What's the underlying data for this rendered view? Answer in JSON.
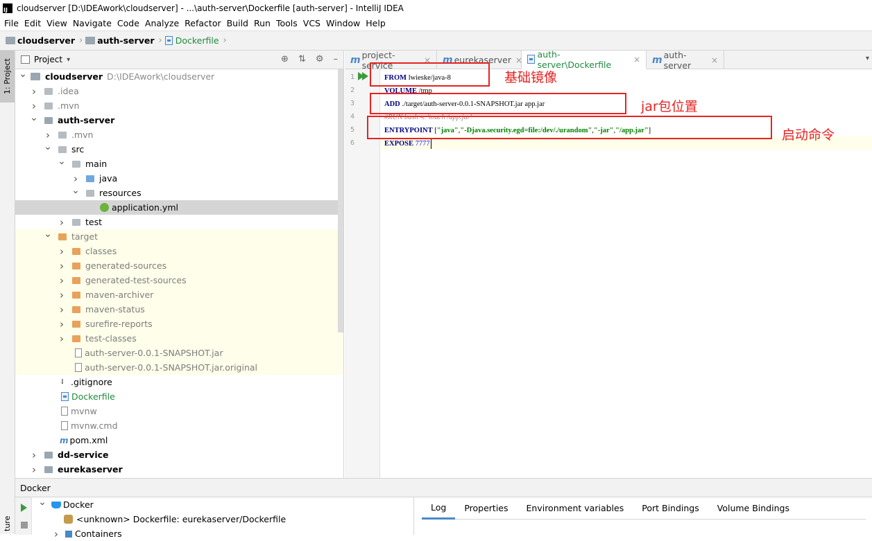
{
  "window": {
    "title": "cloudserver [D:\\IDEAwork\\cloudserver] - ...\\auth-server\\Dockerfile [auth-server] - IntelliJ IDEA",
    "logo": "IJ"
  },
  "menu": [
    "File",
    "Edit",
    "View",
    "Navigate",
    "Code",
    "Analyze",
    "Refactor",
    "Build",
    "Run",
    "Tools",
    "VCS",
    "Window",
    "Help"
  ],
  "breadcrumb": [
    "cloudserver",
    "auth-server",
    "Dockerfile"
  ],
  "left_stripe": {
    "project_tab": "1: Project",
    "structure_tab": "ture"
  },
  "project_panel": {
    "title": "Project",
    "tree": [
      {
        "label": "cloudserver",
        "path": "D:\\IDEAwork\\cloudserver"
      },
      {
        "label": ".idea"
      },
      {
        "label": ".mvn"
      },
      {
        "label": "auth-server"
      },
      {
        "label": ".mvn"
      },
      {
        "label": "src"
      },
      {
        "label": "main"
      },
      {
        "label": "java"
      },
      {
        "label": "resources"
      },
      {
        "label": "application.yml"
      },
      {
        "label": "test"
      },
      {
        "label": "target"
      },
      {
        "label": "classes"
      },
      {
        "label": "generated-sources"
      },
      {
        "label": "generated-test-sources"
      },
      {
        "label": "maven-archiver"
      },
      {
        "label": "maven-status"
      },
      {
        "label": "surefire-reports"
      },
      {
        "label": "test-classes"
      },
      {
        "label": "auth-server-0.0.1-SNAPSHOT.jar"
      },
      {
        "label": "auth-server-0.0.1-SNAPSHOT.jar.original"
      },
      {
        "label": ".gitignore"
      },
      {
        "label": "Dockerfile"
      },
      {
        "label": "mvnw"
      },
      {
        "label": "mvnw.cmd"
      },
      {
        "label": "pom.xml"
      },
      {
        "label": "dd-service"
      },
      {
        "label": "eurekaserver"
      }
    ]
  },
  "editor": {
    "tabs": [
      "project-service",
      "eurekaserver",
      "auth-server\\Dockerfile",
      "auth-server"
    ],
    "line_numbers": [
      "1",
      "2",
      "3",
      "4",
      "5",
      "6"
    ],
    "lines": {
      "l1_kw": "FROM",
      "l1_rest": " lwieske/java-8",
      "l2_kw": "VOLUME",
      "l2_rest": " /tmp",
      "l3_kw": "ADD",
      "l3_rest": " ./target/auth-server-0.0.1-SNAPSHOT.jar app.jar",
      "l4": "#RUN bash -c 'touch /app.jar'",
      "l5_kw": "ENTRYPOINT",
      "l5_open": " [",
      "l5_s1": "\"java\"",
      "l5_c1": ",",
      "l5_s2": "\"-Djava.security.egd=file:/dev/./urandom\"",
      "l5_c2": ",",
      "l5_s3": "\"-jar\"",
      "l5_c3": ",",
      "l5_s4": "\"/app.jar\"",
      "l5_close": "]",
      "l6_kw": "EXPOSE",
      "l6_num": " 7777"
    },
    "annotations": [
      "基础镜像",
      "jar包位置",
      "启动命令"
    ]
  },
  "docker_panel": {
    "title": "Docker",
    "tree": [
      {
        "label": "Docker"
      },
      {
        "label": "<unknown> Dockerfile: eurekaserver/Dockerfile"
      },
      {
        "label": "Containers"
      }
    ],
    "tabs": [
      "Log",
      "Properties",
      "Environment variables",
      "Port Bindings",
      "Volume Bindings"
    ],
    "active_tab": "Log"
  },
  "colors": {
    "annotation": "#e62222",
    "accent": "#4a88c7",
    "keyword": "#000080",
    "string": "#008000"
  }
}
